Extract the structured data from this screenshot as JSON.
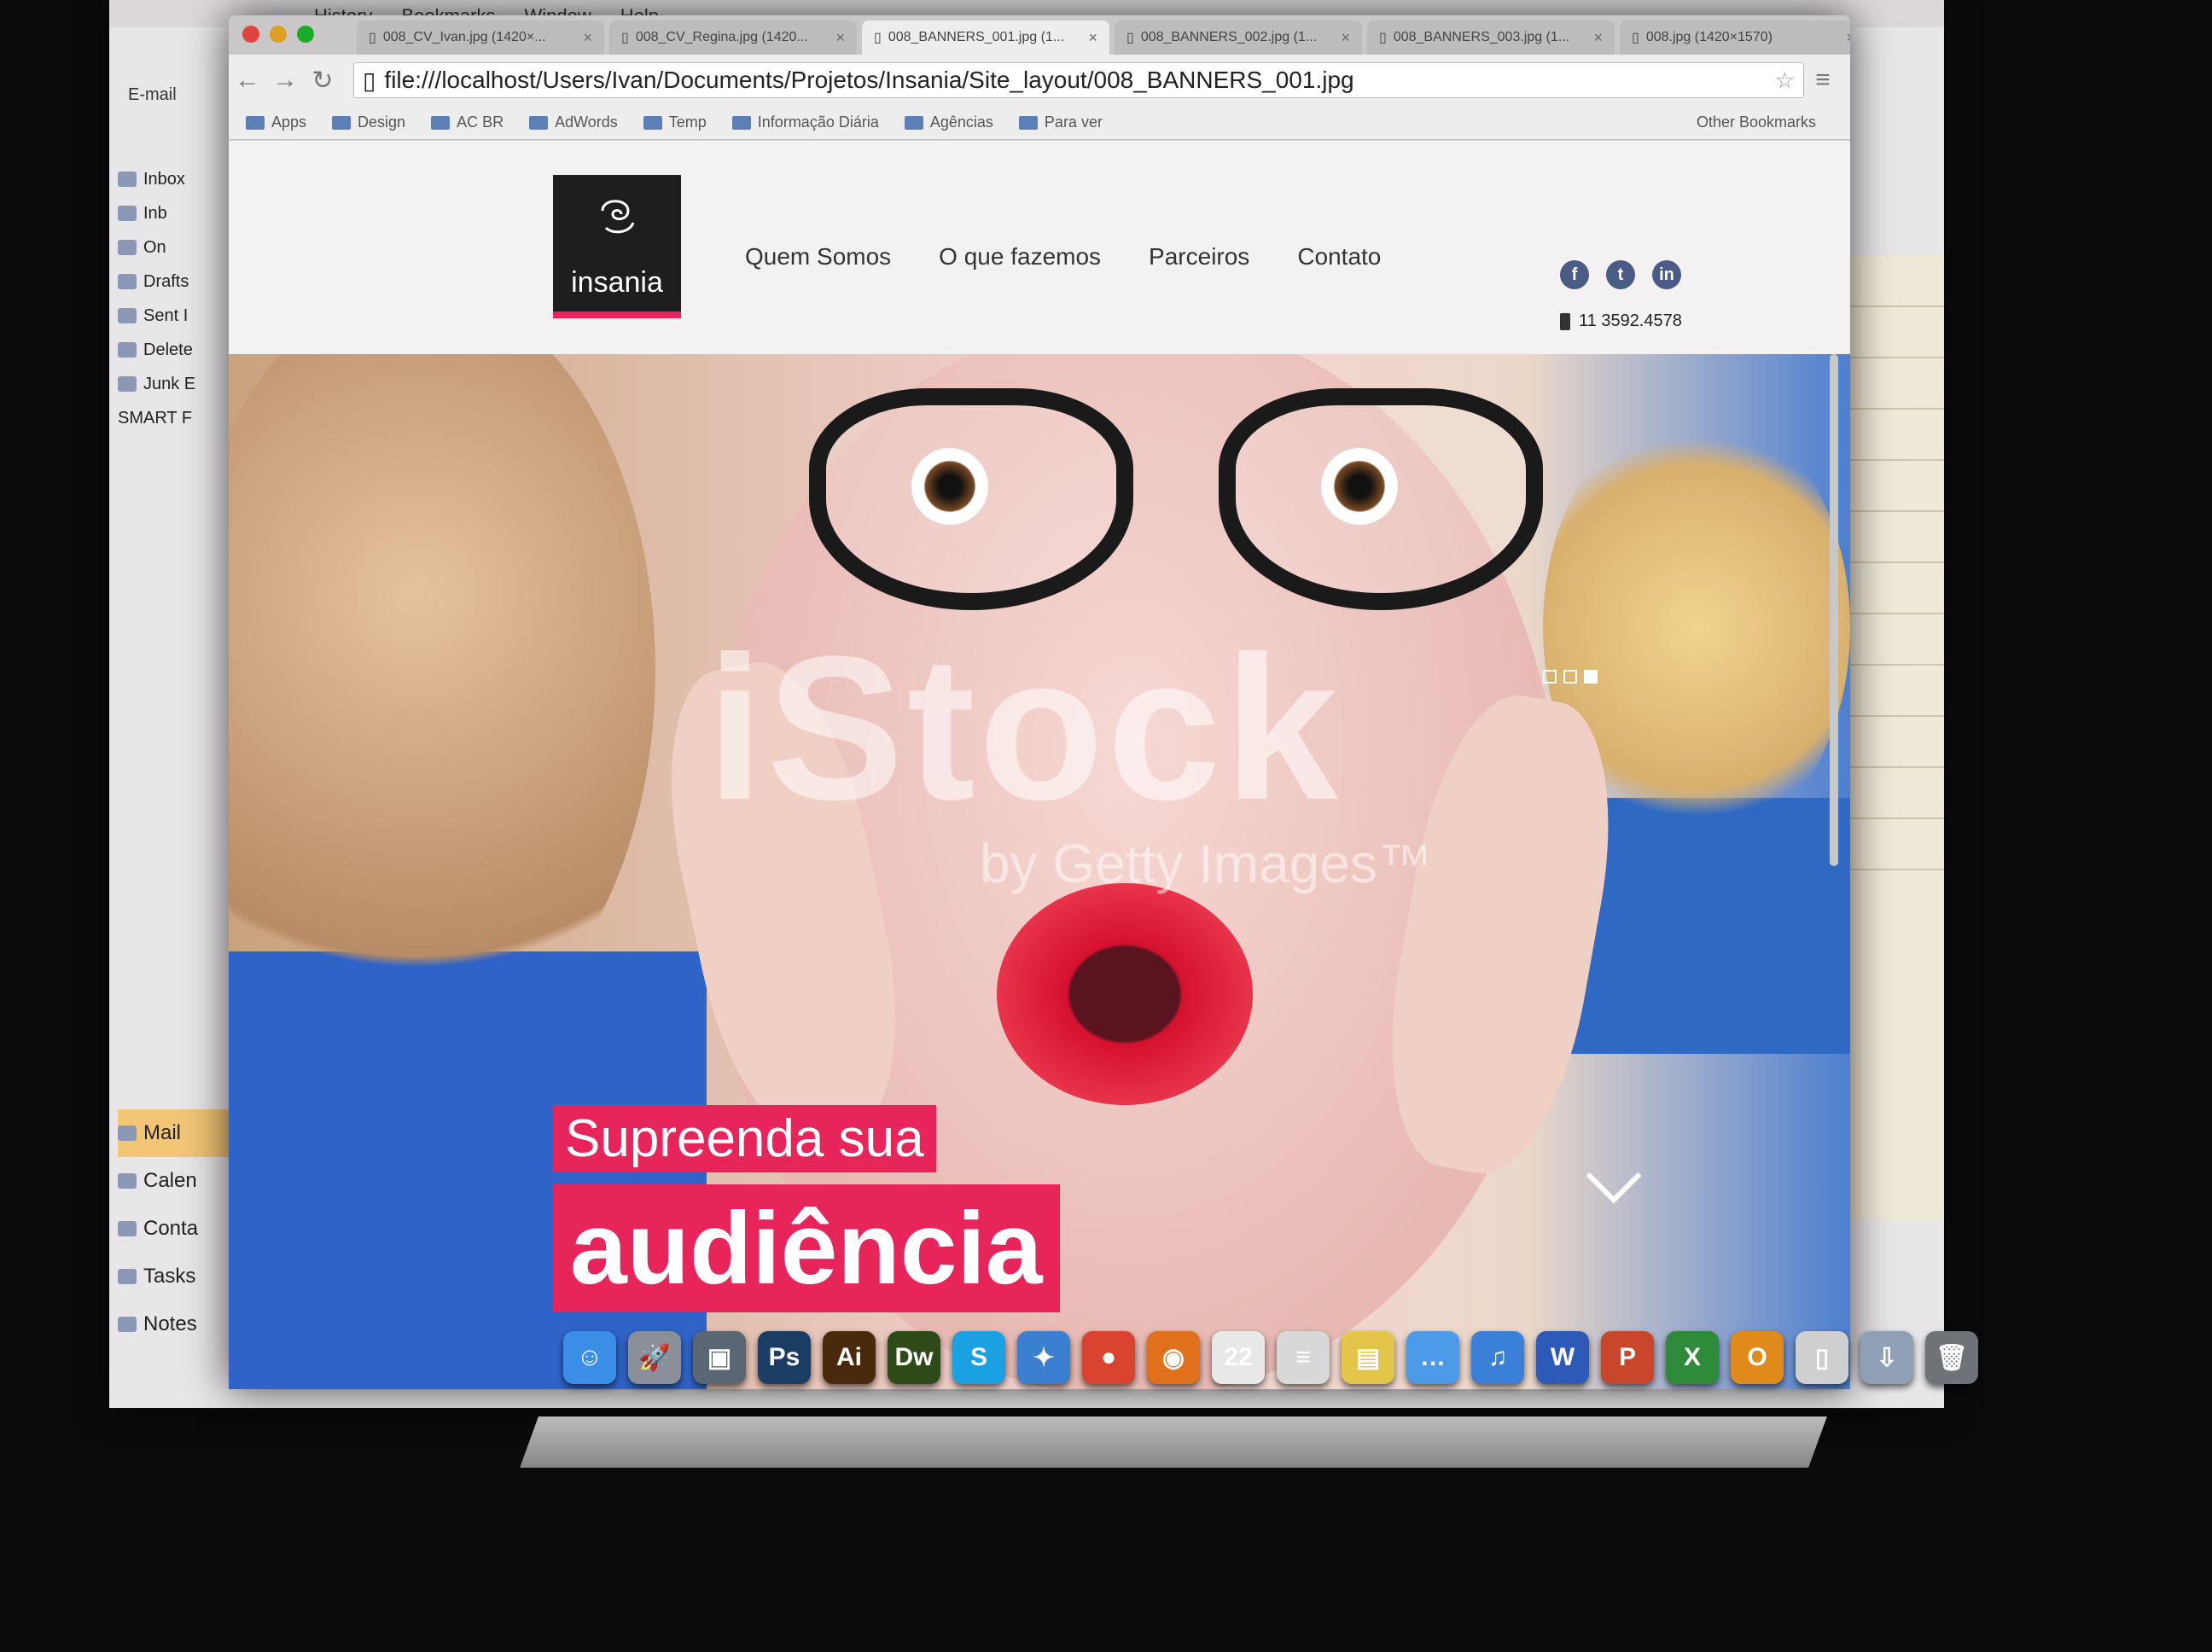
{
  "outlook": {
    "menu": [
      "History",
      "Bookmarks",
      "Window",
      "Help"
    ],
    "toolbar_email_label": "E-mail",
    "folders": [
      "Inbox",
      "Inb",
      "On",
      "Drafts",
      "Sent I",
      "Delete",
      "Junk E",
      "SMART F"
    ],
    "nav": [
      "Mail",
      "Calen",
      "Conta",
      "Tasks",
      "Notes"
    ]
  },
  "chrome": {
    "tabs": [
      {
        "label": "008_CV_Ivan.jpg (1420×...",
        "active": false
      },
      {
        "label": "008_CV_Regina.jpg (1420...",
        "active": false
      },
      {
        "label": "008_BANNERS_001.jpg (1...",
        "active": true
      },
      {
        "label": "008_BANNERS_002.jpg (1...",
        "active": false
      },
      {
        "label": "008_BANNERS_003.jpg (1...",
        "active": false
      },
      {
        "label": "008.jpg (1420×1570)",
        "active": false
      }
    ],
    "url": "file:///localhost/Users/Ivan/Documents/Projetos/Insania/Site_layout/008_BANNERS_001.jpg",
    "bookmarks": [
      "Apps",
      "Design",
      "AC BR",
      "AdWords",
      "Temp",
      "Informação Diária",
      "Agências",
      "Para ver"
    ],
    "other_bookmarks": "Other Bookmarks"
  },
  "site": {
    "logo_text": "insania",
    "nav": [
      "Quem Somos",
      "O que fazemos",
      "Parceiros",
      "Contato"
    ],
    "social": [
      {
        "name": "facebook-icon",
        "glyph": "f"
      },
      {
        "name": "twitter-icon",
        "glyph": "t"
      },
      {
        "name": "linkedin-icon",
        "glyph": "in"
      }
    ],
    "phone": "11 3592.4578",
    "watermark": "iStock",
    "watermark_sub": "by Getty Images™",
    "headline_line1": "Supreenda sua",
    "headline_line2": "audiência",
    "accent_color": "#e8255b"
  },
  "dock": {
    "apps": [
      {
        "name": "finder-icon",
        "glyph": "☺",
        "color": "#3a8ee6"
      },
      {
        "name": "launchpad-icon",
        "glyph": "🚀",
        "color": "#8a8f99"
      },
      {
        "name": "photo-icon",
        "glyph": "▣",
        "color": "#5b6675"
      },
      {
        "name": "photoshop-icon",
        "glyph": "Ps",
        "color": "#1b3d63"
      },
      {
        "name": "illustrator-icon",
        "glyph": "Ai",
        "color": "#4a2a0c"
      },
      {
        "name": "dreamweaver-icon",
        "glyph": "Dw",
        "color": "#2e4a16"
      },
      {
        "name": "skype-icon",
        "glyph": "S",
        "color": "#1aa1e1"
      },
      {
        "name": "safari-icon",
        "glyph": "✦",
        "color": "#3b7fd1"
      },
      {
        "name": "chrome-icon",
        "glyph": "●",
        "color": "#d9432f"
      },
      {
        "name": "firefox-icon",
        "glyph": "◉",
        "color": "#e0701c"
      },
      {
        "name": "calendar-icon",
        "glyph": "22",
        "color": "#e8e8e8"
      },
      {
        "name": "textedit-icon",
        "glyph": "≡",
        "color": "#d8d8d8"
      },
      {
        "name": "stickies-icon",
        "glyph": "▤",
        "color": "#e3c54a"
      },
      {
        "name": "messages-icon",
        "glyph": "…",
        "color": "#4c9be8"
      },
      {
        "name": "itunes-icon",
        "glyph": "♫",
        "color": "#3a7fd8"
      },
      {
        "name": "word-icon",
        "glyph": "W",
        "color": "#2d5ab8"
      },
      {
        "name": "powerpoint-icon",
        "glyph": "P",
        "color": "#c8472c"
      },
      {
        "name": "excel-icon",
        "glyph": "X",
        "color": "#2e8b3a"
      },
      {
        "name": "outlook-icon",
        "glyph": "O",
        "color": "#e08a1c"
      },
      {
        "name": "document-icon",
        "glyph": "▯",
        "color": "#cfcfcf"
      },
      {
        "name": "downloads-icon",
        "glyph": "⇩",
        "color": "#8f9fb5"
      },
      {
        "name": "trash-icon",
        "glyph": "🗑",
        "color": "#6f7378"
      }
    ]
  }
}
